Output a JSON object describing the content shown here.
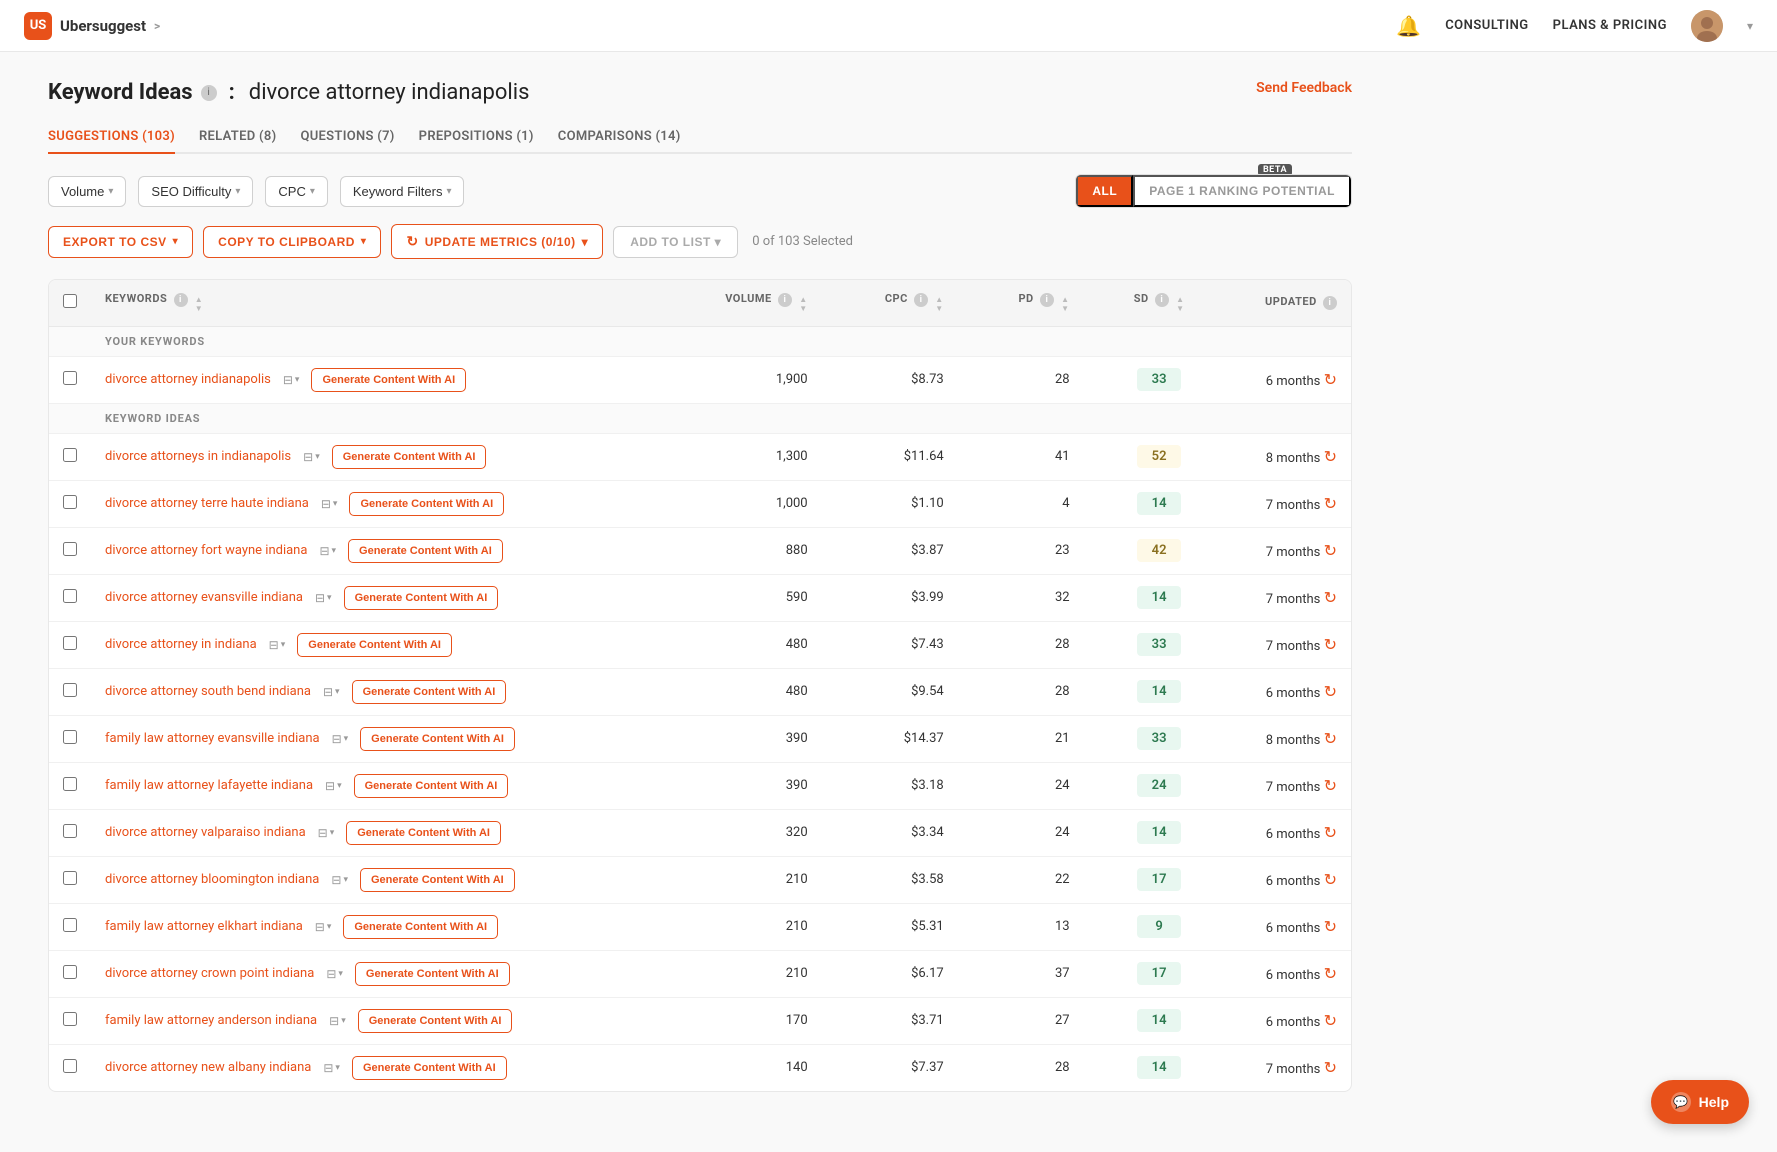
{
  "nav": {
    "logo_text": "Ubersuggest",
    "logo_badge": "US",
    "chevron": ">",
    "links": [
      "CONSULTING",
      "PLANS & PRICING"
    ],
    "bell_icon": "🔔"
  },
  "page": {
    "title_bold": "Keyword Ideas",
    "title_separator": ":",
    "title_keyword": "divorce attorney indianapolis",
    "send_feedback": "Send Feedback"
  },
  "tabs": [
    {
      "label": "SUGGESTIONS (103)",
      "active": true
    },
    {
      "label": "RELATED (8)",
      "active": false
    },
    {
      "label": "QUESTIONS (7)",
      "active": false
    },
    {
      "label": "PREPOSITIONS (1)",
      "active": false
    },
    {
      "label": "COMPARISONS (14)",
      "active": false
    }
  ],
  "filters": [
    {
      "label": "Volume",
      "has_chevron": true
    },
    {
      "label": "SEO Difficulty",
      "has_chevron": true
    },
    {
      "label": "CPC",
      "has_chevron": true
    },
    {
      "label": "Keyword Filters",
      "has_chevron": true
    }
  ],
  "ranking_tabs": [
    {
      "label": "ALL",
      "active": true
    },
    {
      "label": "PAGE 1 RANKING POTENTIAL",
      "active": false
    }
  ],
  "beta_label": "BETA",
  "actions": {
    "export_csv": "EXPORT TO CSV",
    "copy_clipboard": "COPY TO CLIPBOARD",
    "update_metrics": "UPDATE METRICS (0/10)",
    "add_to_list": "ADD TO LIST",
    "selected_text": "0 of 103 Selected"
  },
  "table": {
    "headers": [
      {
        "key": "keywords",
        "label": "KEYWORDS",
        "sortable": true,
        "info": true
      },
      {
        "key": "volume",
        "label": "VOLUME",
        "sortable": true,
        "info": true
      },
      {
        "key": "cpc",
        "label": "CPC",
        "sortable": true,
        "info": true
      },
      {
        "key": "pd",
        "label": "PD",
        "sortable": true,
        "info": true
      },
      {
        "key": "sd",
        "label": "SD",
        "sortable": true,
        "info": true
      },
      {
        "key": "updated",
        "label": "UPDATED",
        "sortable": false,
        "info": true
      }
    ],
    "section_your_keywords": "YOUR KEYWORDS",
    "section_keyword_ideas": "KEYWORD IDEAS",
    "gen_button_label": "Generate Content With AI",
    "rows_your_keywords": [
      {
        "keyword": "divorce attorney indianapolis",
        "volume": "1,900",
        "cpc": "$8.73",
        "pd": "28",
        "sd": 33,
        "sd_type": "green",
        "updated": "6 months"
      }
    ],
    "rows_keyword_ideas": [
      {
        "keyword": "divorce attorneys in indianapolis",
        "volume": "1,300",
        "cpc": "$11.64",
        "pd": "41",
        "sd": 52,
        "sd_type": "yellow",
        "updated": "8 months"
      },
      {
        "keyword": "divorce attorney terre haute indiana",
        "volume": "1,000",
        "cpc": "$1.10",
        "pd": "4",
        "sd": 14,
        "sd_type": "green",
        "updated": "7 months"
      },
      {
        "keyword": "divorce attorney fort wayne indiana",
        "volume": "880",
        "cpc": "$3.87",
        "pd": "23",
        "sd": 42,
        "sd_type": "yellow",
        "updated": "7 months"
      },
      {
        "keyword": "divorce attorney evansville indiana",
        "volume": "590",
        "cpc": "$3.99",
        "pd": "32",
        "sd": 14,
        "sd_type": "green",
        "updated": "7 months"
      },
      {
        "keyword": "divorce attorney in indiana",
        "volume": "480",
        "cpc": "$7.43",
        "pd": "28",
        "sd": 33,
        "sd_type": "green",
        "updated": "7 months"
      },
      {
        "keyword": "divorce attorney south bend indiana",
        "volume": "480",
        "cpc": "$9.54",
        "pd": "28",
        "sd": 14,
        "sd_type": "green",
        "updated": "6 months"
      },
      {
        "keyword": "family law attorney evansville indiana",
        "volume": "390",
        "cpc": "$14.37",
        "pd": "21",
        "sd": 33,
        "sd_type": "green",
        "updated": "8 months"
      },
      {
        "keyword": "family law attorney lafayette indiana",
        "volume": "390",
        "cpc": "$3.18",
        "pd": "24",
        "sd": 24,
        "sd_type": "green",
        "updated": "7 months"
      },
      {
        "keyword": "divorce attorney valparaiso indiana",
        "volume": "320",
        "cpc": "$3.34",
        "pd": "24",
        "sd": 14,
        "sd_type": "green",
        "updated": "6 months"
      },
      {
        "keyword": "divorce attorney bloomington indiana",
        "volume": "210",
        "cpc": "$3.58",
        "pd": "22",
        "sd": 17,
        "sd_type": "green",
        "updated": "6 months"
      },
      {
        "keyword": "family law attorney elkhart indiana",
        "volume": "210",
        "cpc": "$5.31",
        "pd": "13",
        "sd": 9,
        "sd_type": "green",
        "updated": "6 months"
      },
      {
        "keyword": "divorce attorney crown point indiana",
        "volume": "210",
        "cpc": "$6.17",
        "pd": "37",
        "sd": 17,
        "sd_type": "green",
        "updated": "6 months"
      },
      {
        "keyword": "family law attorney anderson indiana",
        "volume": "170",
        "cpc": "$3.71",
        "pd": "27",
        "sd": 14,
        "sd_type": "green",
        "updated": "6 months"
      },
      {
        "keyword": "divorce attorney new albany indiana",
        "volume": "140",
        "cpc": "$7.37",
        "pd": "28",
        "sd": 14,
        "sd_type": "green",
        "updated": "7 months"
      }
    ]
  },
  "help": {
    "label": "Help"
  }
}
